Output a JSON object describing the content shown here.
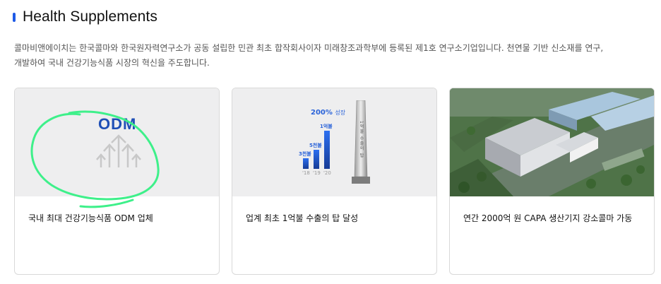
{
  "section": {
    "title": "Health Supplements",
    "intro_line1": "콜마비앤에이치는 한국콜마와 한국원자력연구소가 공동 설립한 민관 최초 합작회사이자 미래창조과학부에 등록된 제1호 연구소기업입니다. 천연물 기반 신소재를 연구,",
    "intro_line2": "개발하여 국내 건강기능식품 시장의 혁신을 주도합니다."
  },
  "cards": [
    {
      "caption": "국내 최대 건강기능식품 ODM 업체",
      "image_text": "ODM",
      "icon": "odm-arrows-icon"
    },
    {
      "caption": "업계 최초 1억불 수출의 탑 달성",
      "growth_label": "200%",
      "growth_sub": "성장",
      "bars": [
        {
          "label": "3천불",
          "year": "'18",
          "value": 30
        },
        {
          "label": "5천불",
          "year": "'19",
          "value": 50
        },
        {
          "label": "1억불",
          "year": "'20",
          "value": 100
        }
      ],
      "tower_text": "1억불 수출의 탑"
    },
    {
      "caption": "연간 2000억 원 CAPA 생산기지 강소콜마 가동",
      "image": "factory-aerial-photo"
    }
  ],
  "annotation": {
    "color": "#3ef08a"
  }
}
